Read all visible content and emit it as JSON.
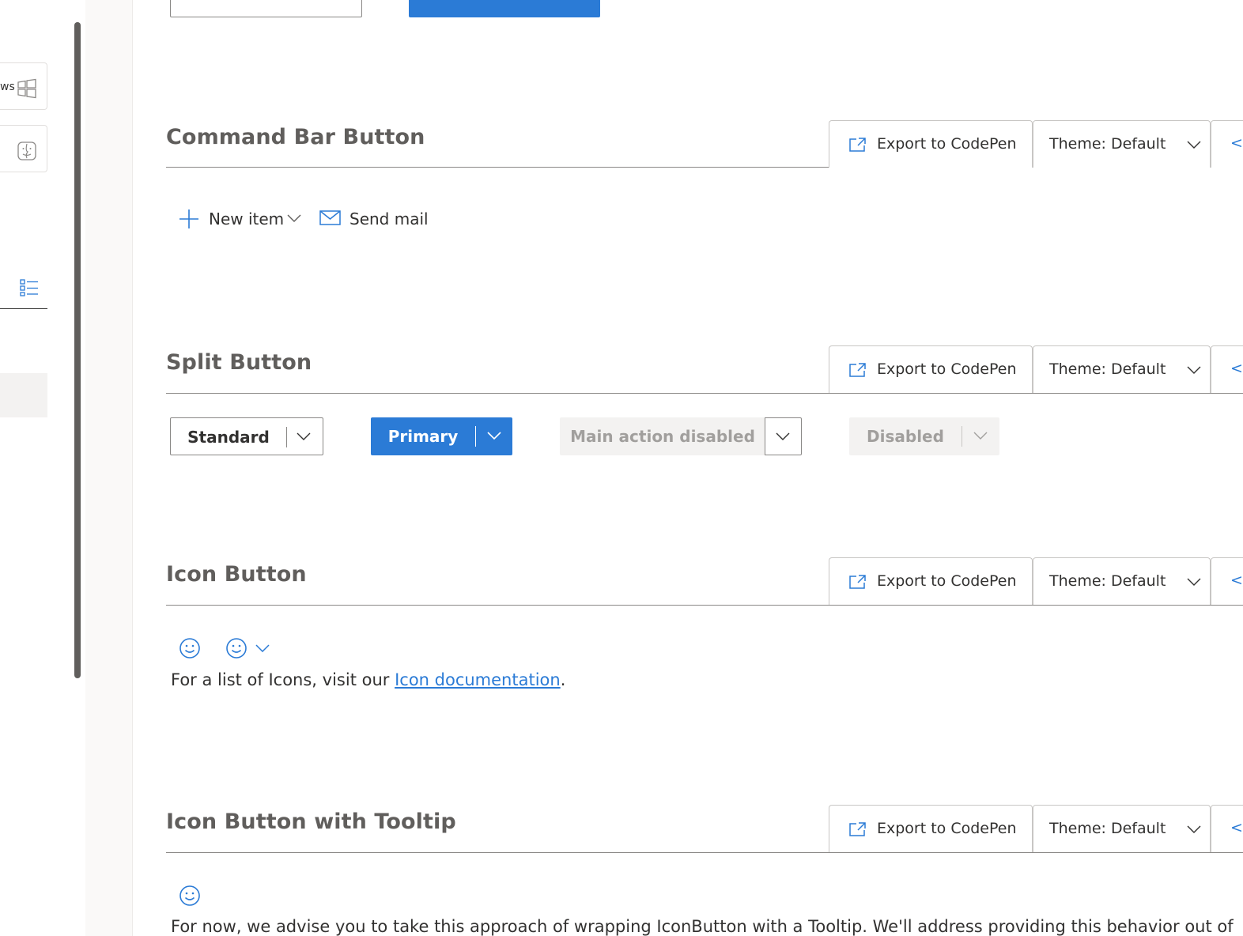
{
  "nav": {
    "windows_label": "ws",
    "windows_icon": "windows-icon",
    "mac_icon": "finder-icon",
    "list_icon": "bulleted-list-icon"
  },
  "toolbar": {
    "export_label": "Export to CodePen",
    "theme_label": "Theme: Default",
    "code_label": "</"
  },
  "sections": {
    "command_bar": {
      "title": "Command Bar Button"
    },
    "split": {
      "title": "Split Button"
    },
    "icon": {
      "title": "Icon Button"
    },
    "tooltip": {
      "title": "Icon Button with Tooltip"
    }
  },
  "command_bar": {
    "new_item_label": "New item",
    "send_mail_label": "Send mail"
  },
  "split_buttons": {
    "standard": "Standard",
    "primary": "Primary",
    "main_disabled": "Main action disabled",
    "disabled": "Disabled"
  },
  "icon_section": {
    "text_before": "For a list of Icons, visit our ",
    "link_text": "Icon documentation",
    "text_after": "."
  },
  "tooltip_section": {
    "text": "For now, we advise you to take this approach of wrapping IconButton with a Tooltip. We'll address providing this behavior out of"
  },
  "colors": {
    "accent": "#2b7bd6",
    "disabled_bg": "#f3f2f1",
    "disabled_text": "#a19f9d",
    "title_text": "#605e5c"
  }
}
